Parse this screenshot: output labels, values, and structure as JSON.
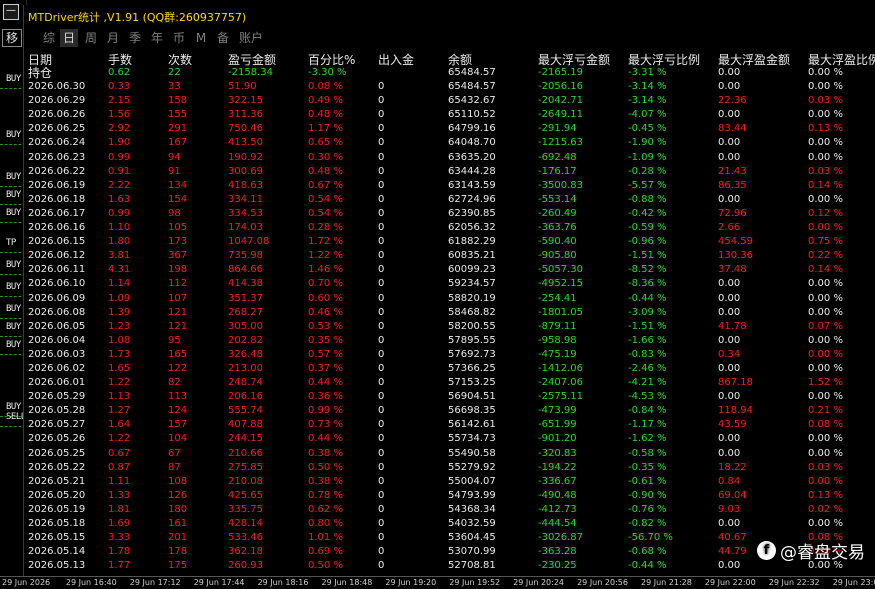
{
  "window": {
    "title": "MTDriver统计 ,V1.91 (QQ群:260937757)",
    "close_glyph": "—",
    "move_label": "移"
  },
  "toolbar": {
    "tabs": [
      "综",
      "日",
      "周",
      "月",
      "季",
      "年",
      "币",
      "M",
      "备",
      "账户"
    ],
    "active": "日"
  },
  "left_strip": {
    "labels": [
      "BUY",
      "BUY",
      "BUY",
      "BUY",
      "BUY",
      "TP",
      "BUY",
      "BUY",
      "BUY",
      "BUY",
      "BUY",
      "BUY",
      "SELL"
    ]
  },
  "table": {
    "headers": [
      "日期",
      "手数",
      "次数",
      "盈亏金额",
      "百分比%",
      "出入金",
      "余额",
      "最大浮亏金额",
      "最大浮亏比例",
      "最大浮盈金额",
      "最大浮盈比例"
    ],
    "holding": [
      "持仓",
      "0.62",
      "22",
      "-2158.34",
      "-3.30 %",
      "",
      "65484.57",
      "-2165.19",
      "-3.31 %",
      "0.00",
      "0.00 %"
    ],
    "rows": [
      [
        "2026.06.30",
        "0.33",
        "33",
        "51.90",
        "0.08 %",
        "0",
        "65484.57",
        "-2056.16",
        "-3.14 %",
        "0.00",
        "0.00 %"
      ],
      [
        "2026.06.29",
        "2.15",
        "158",
        "322.15",
        "0.49 %",
        "0",
        "65432.67",
        "-2042.71",
        "-3.14 %",
        "22.36",
        "0.03 %"
      ],
      [
        "2026.06.26",
        "1.56",
        "155",
        "311.36",
        "0.48 %",
        "0",
        "65110.52",
        "-2649.11",
        "-4.07 %",
        "0.00",
        "0.00 %"
      ],
      [
        "2026.06.25",
        "2.92",
        "291",
        "750.46",
        "1.17 %",
        "0",
        "64799.16",
        "-291.94",
        "-0.45 %",
        "83.44",
        "0.13 %"
      ],
      [
        "2026.06.24",
        "1.90",
        "167",
        "413.50",
        "0.65 %",
        "0",
        "64048.70",
        "-1215.63",
        "-1.90 %",
        "0.00",
        "0.00 %"
      ],
      [
        "2026.06.23",
        "0.99",
        "94",
        "190.92",
        "0.30 %",
        "0",
        "63635.20",
        "-692.48",
        "-1.09 %",
        "0.00",
        "0.00 %"
      ],
      [
        "2026.06.22",
        "0.91",
        "91",
        "300.69",
        "0.48 %",
        "0",
        "63444.28",
        "-176.17",
        "-0.28 %",
        "21.43",
        "0.03 %"
      ],
      [
        "2026.06.19",
        "2.22",
        "134",
        "418.63",
        "0.67 %",
        "0",
        "63143.59",
        "-3500.83",
        "-5.57 %",
        "86.35",
        "0.14 %"
      ],
      [
        "2026.06.18",
        "1.63",
        "154",
        "334.11",
        "0.54 %",
        "0",
        "62724.96",
        "-553.14",
        "-0.88 %",
        "0.00",
        "0.00 %"
      ],
      [
        "2026.06.17",
        "0.99",
        "98",
        "334.53",
        "0.54 %",
        "0",
        "62390.85",
        "-260.49",
        "-0.42 %",
        "72.96",
        "0.12 %"
      ],
      [
        "2026.06.16",
        "1.10",
        "105",
        "174.03",
        "0.28 %",
        "0",
        "62056.32",
        "-363.76",
        "-0.59 %",
        "2.66",
        "0.00 %"
      ],
      [
        "2026.06.15",
        "1.80",
        "173",
        "1047.08",
        "1.72 %",
        "0",
        "61882.29",
        "-590.40",
        "-0.96 %",
        "454.59",
        "0.75 %"
      ],
      [
        "2026.06.12",
        "3.81",
        "367",
        "735.98",
        "1.22 %",
        "0",
        "60835.21",
        "-905.80",
        "-1.51 %",
        "130.36",
        "0.22 %"
      ],
      [
        "2026.06.11",
        "4.31",
        "198",
        "864.66",
        "1.46 %",
        "0",
        "60099.23",
        "-5057.30",
        "-8.52 %",
        "37.48",
        "0.14 %"
      ],
      [
        "2026.06.10",
        "1.14",
        "112",
        "414.38",
        "0.70 %",
        "0",
        "59234.57",
        "-4952.15",
        "-8.36 %",
        "0.00",
        "0.00 %"
      ],
      [
        "2026.06.09",
        "1.09",
        "107",
        "351.37",
        "0.60 %",
        "0",
        "58820.19",
        "-254.41",
        "-0.44 %",
        "0.00",
        "0.00 %"
      ],
      [
        "2026.06.08",
        "1.39",
        "121",
        "268.27",
        "0.46 %",
        "0",
        "58468.82",
        "-1801.05",
        "-3.09 %",
        "0.00",
        "0.00 %"
      ],
      [
        "2026.06.05",
        "1.23",
        "121",
        "305.00",
        "0.53 %",
        "0",
        "58200.55",
        "-879.11",
        "-1.51 %",
        "41.78",
        "0.07 %"
      ],
      [
        "2026.06.04",
        "1.08",
        "95",
        "202.82",
        "0.35 %",
        "0",
        "57895.55",
        "-958.98",
        "-1.66 %",
        "0.00",
        "0.00 %"
      ],
      [
        "2026.06.03",
        "1.73",
        "165",
        "326.48",
        "0.57 %",
        "0",
        "57692.73",
        "-475.19",
        "-0.83 %",
        "0.34",
        "0.00 %"
      ],
      [
        "2026.06.02",
        "1.65",
        "122",
        "213.00",
        "0.37 %",
        "0",
        "57366.25",
        "-1412.06",
        "-2.46 %",
        "0.00",
        "0.00 %"
      ],
      [
        "2026.06.01",
        "1.22",
        "82",
        "248.74",
        "0.44 %",
        "0",
        "57153.25",
        "-2407.06",
        "-4.21 %",
        "867.18",
        "1.52 %"
      ],
      [
        "2026.05.29",
        "1.13",
        "113",
        "206.16",
        "0.36 %",
        "0",
        "56904.51",
        "-2575.11",
        "-4.53 %",
        "0.00",
        "0.00 %"
      ],
      [
        "2026.05.28",
        "1.27",
        "124",
        "555.74",
        "0.99 %",
        "0",
        "56698.35",
        "-473.99",
        "-0.84 %",
        "118.94",
        "0.21 %"
      ],
      [
        "2026.05.27",
        "1.64",
        "157",
        "407.88",
        "0.73 %",
        "0",
        "56142.61",
        "-651.99",
        "-1.17 %",
        "43.59",
        "0.08 %"
      ],
      [
        "2026.05.26",
        "1.22",
        "104",
        "244.15",
        "0.44 %",
        "0",
        "55734.73",
        "-901.20",
        "-1.62 %",
        "0.00",
        "0.00 %"
      ],
      [
        "2026.05.25",
        "0.67",
        "67",
        "210.66",
        "0.38 %",
        "0",
        "55490.58",
        "-320.83",
        "-0.58 %",
        "0.00",
        "0.00 %"
      ],
      [
        "2026.05.22",
        "0.87",
        "87",
        "275.85",
        "0.50 %",
        "0",
        "55279.92",
        "-194.22",
        "-0.35 %",
        "18.22",
        "0.03 %"
      ],
      [
        "2026.05.21",
        "1.11",
        "108",
        "210.08",
        "0.38 %",
        "0",
        "55004.07",
        "-336.67",
        "-0.61 %",
        "0.84",
        "0.00 %"
      ],
      [
        "2026.05.20",
        "1.33",
        "126",
        "425.65",
        "0.78 %",
        "0",
        "54793.99",
        "-490.48",
        "-0.90 %",
        "69.04",
        "0.13 %"
      ],
      [
        "2026.05.19",
        "1.81",
        "180",
        "335.75",
        "0.62 %",
        "0",
        "54368.34",
        "-412.73",
        "-0.76 %",
        "9.03",
        "0.02 %"
      ],
      [
        "2026.05.18",
        "1.69",
        "161",
        "428.14",
        "0.80 %",
        "0",
        "54032.59",
        "-444.54",
        "-0.82 %",
        "0.00",
        "0.00 %"
      ],
      [
        "2026.05.15",
        "3.33",
        "201",
        "533.46",
        "1.01 %",
        "0",
        "53604.45",
        "-3026.87",
        "-56.70 %",
        "40.67",
        "0.08 %"
      ],
      [
        "2026.05.14",
        "1.78",
        "178",
        "362.18",
        "0.69 %",
        "0",
        "53070.99",
        "-363.28",
        "-0.68 %",
        "44.79",
        "0.08 %"
      ],
      [
        "2026.05.13",
        "1.77",
        "175",
        "260.93",
        "0.50 %",
        "0",
        "52708.81",
        "-230.25",
        "-0.44 %",
        "0.00",
        "0.00 %"
      ]
    ]
  },
  "time_axis": [
    "29 Jun 2026",
    "29 Jun 16:40",
    "29 Jun 17:12",
    "29 Jun 17:44",
    "29 Jun 18:16",
    "29 Jun 18:48",
    "29 Jun 19:20",
    "29 Jun 19:52",
    "29 Jun 20:24",
    "29 Jun 20:56",
    "29 Jun 21:28",
    "29 Jun 22:00",
    "29 Jun 22:32",
    "29 Jun 23:04"
  ],
  "watermark": {
    "text": "@睿盘交易",
    "logo": "f"
  },
  "colors": {
    "title": "#ffd700",
    "profit": "#ff1a1a",
    "loss": "#22dd22",
    "neutral": "#eaeaea"
  }
}
